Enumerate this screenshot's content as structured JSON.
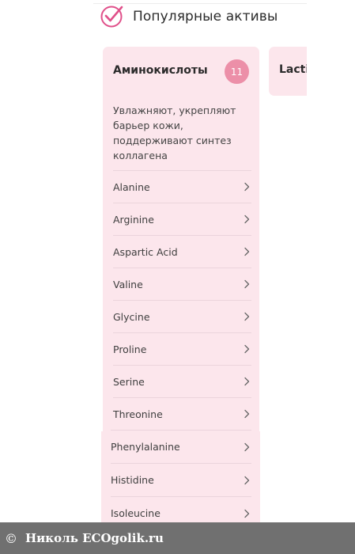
{
  "header": {
    "title": "Популярные активы",
    "icon": "checkmark-circle-icon",
    "accent_color": "#e0508a"
  },
  "category": {
    "title": "Аминокислоты",
    "count": "11",
    "description": "Увлажняют, укрепляют барьер кожи, поддерживают синтез коллагена",
    "card_color": "#fce6ec",
    "badge_color": "#ec8fa8",
    "items": [
      {
        "label": "Alanine"
      },
      {
        "label": "Arginine"
      },
      {
        "label": "Aspartic Acid"
      },
      {
        "label": "Valine"
      },
      {
        "label": "Glycine"
      },
      {
        "label": "Proline"
      },
      {
        "label": "Serine"
      },
      {
        "label": "Threonine"
      },
      {
        "label": "Phenylalanine"
      },
      {
        "label": "Histidine"
      },
      {
        "label": "Isoleucine"
      }
    ]
  },
  "next_category": {
    "title": "Lacti"
  },
  "footer": {
    "copyright_symbol": "©",
    "text": "Николь  ECOgolik.ru"
  }
}
